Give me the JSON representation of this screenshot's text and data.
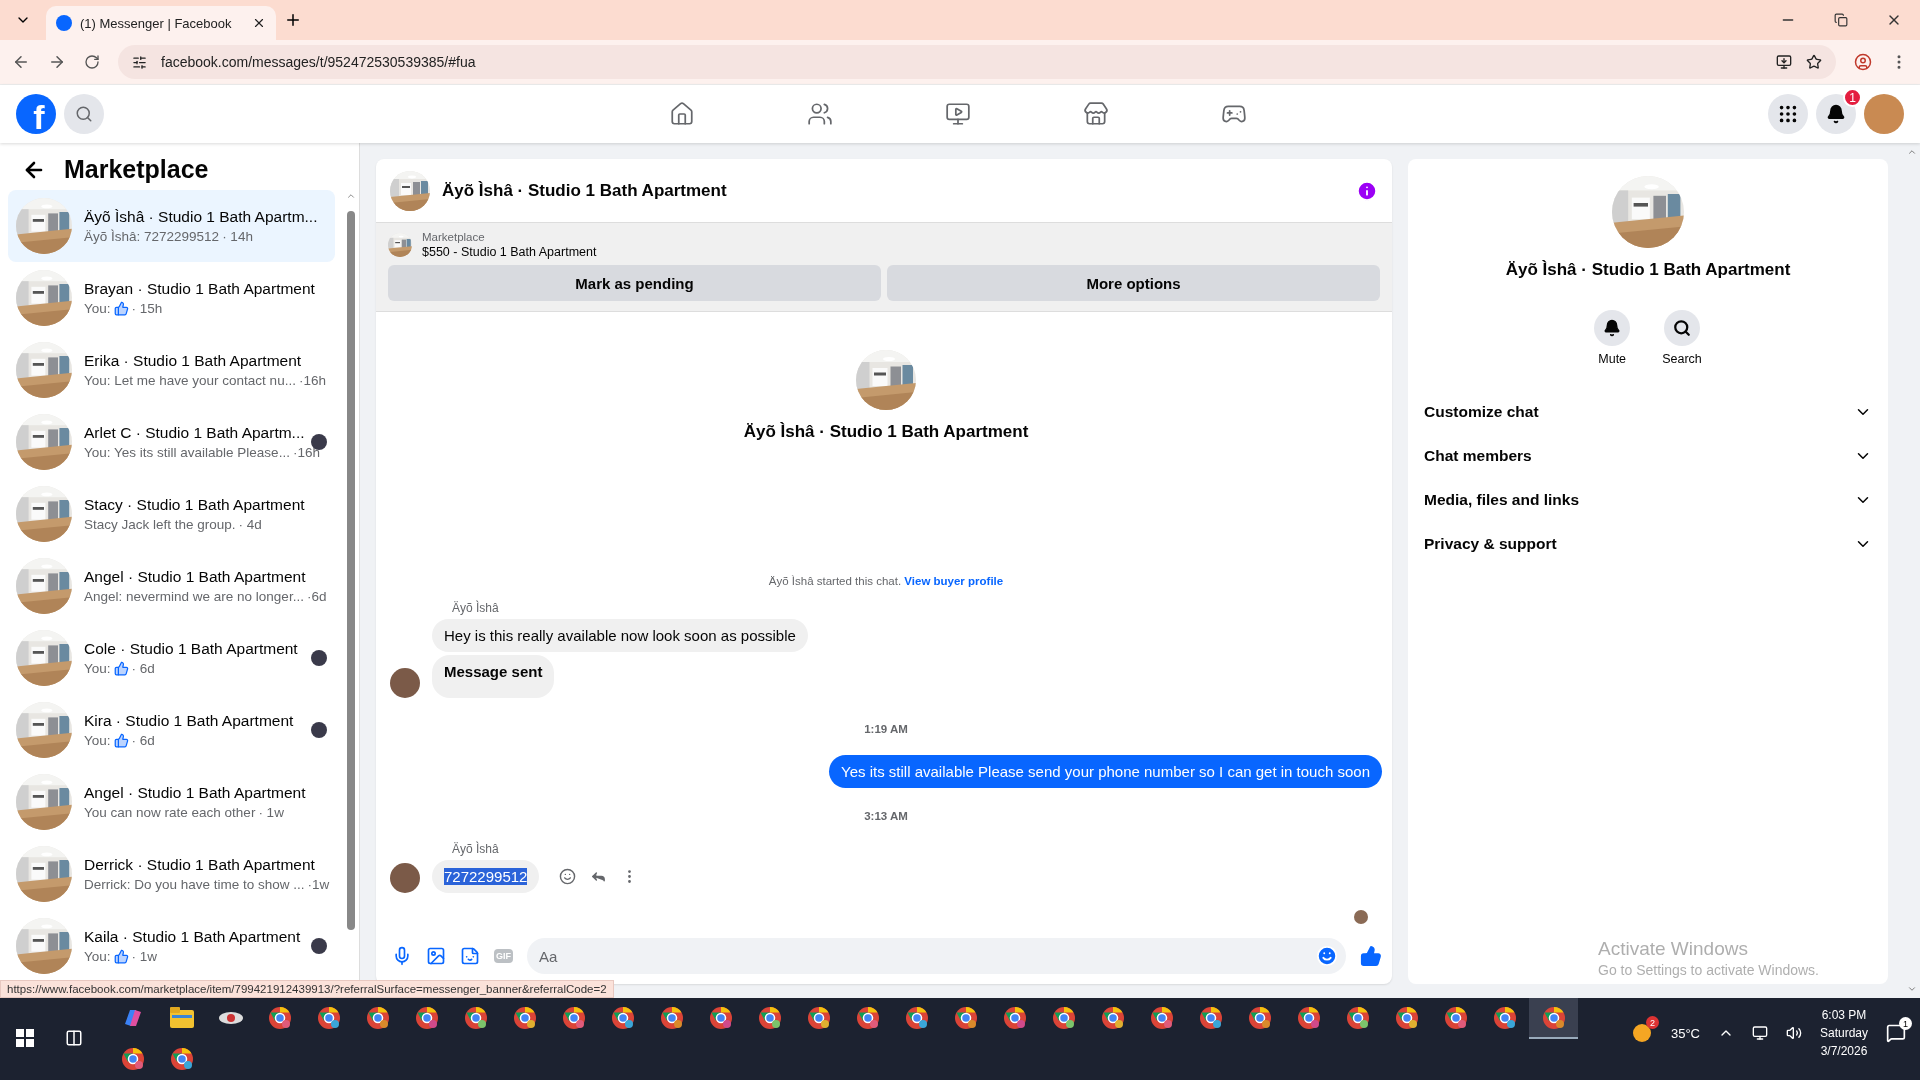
{
  "browser": {
    "tabs": [
      {
        "title": "(1) Messenger | Facebook",
        "selected": true
      }
    ],
    "address": "facebook.com/messages/t/952472530539385/#fua",
    "status_url": "https://www.facebook.com/marketplace/item/799421912439913/?referralSurface=messenger_banner&referralCode=2"
  },
  "header": {
    "logo": "f",
    "notification_count": "1"
  },
  "sidebar": {
    "title": "Marketplace",
    "conversations": [
      {
        "name": "Äyõ Ìshâ · Studio 1 Bath Apartm...",
        "preview": "Äyõ Ìshâ: 7272299512",
        "like": false,
        "time": "· 14h",
        "selected": true,
        "seen": false
      },
      {
        "name": "Brayan · Studio 1 Bath Apartment",
        "preview": "You:",
        "like": true,
        "time": "· 15h",
        "selected": false,
        "seen": false
      },
      {
        "name": "Erika · Studio 1 Bath Apartment",
        "preview": "You: Let me have your contact nu...",
        "like": false,
        "time": "·16h",
        "selected": false,
        "seen": false
      },
      {
        "name": "Arlet C · Studio 1 Bath Apartm...",
        "preview": "You: Yes its still available Please...",
        "like": false,
        "time": "·16h",
        "selected": false,
        "seen": true
      },
      {
        "name": "Stacy · Studio 1 Bath Apartment",
        "preview": "Stacy Jack left the group.",
        "like": false,
        "time": "· 4d",
        "selected": false,
        "seen": false
      },
      {
        "name": "Angel · Studio 1 Bath Apartment",
        "preview": "Angel: nevermind we are no longer...",
        "like": false,
        "time": "·6d",
        "selected": false,
        "seen": false
      },
      {
        "name": "Cole · Studio 1 Bath Apartment",
        "preview": "You:",
        "like": true,
        "time": "· 6d",
        "selected": false,
        "seen": true
      },
      {
        "name": "Kira · Studio 1 Bath Apartment",
        "preview": "You:",
        "like": true,
        "time": "· 6d",
        "selected": false,
        "seen": true
      },
      {
        "name": "Angel · Studio 1 Bath Apartment",
        "preview": "You can now rate each other",
        "like": false,
        "time": "· 1w",
        "selected": false,
        "seen": false
      },
      {
        "name": "Derrick · Studio 1 Bath Apartment",
        "preview": "Derrick: Do you have time to show ...",
        "like": false,
        "time": "·1w",
        "selected": false,
        "seen": false
      },
      {
        "name": "Kaila · Studio 1 Bath Apartment",
        "preview": "You:",
        "like": true,
        "time": "· 1w",
        "selected": false,
        "seen": true
      }
    ]
  },
  "chat": {
    "title": "Äyõ Ìshâ · Studio 1 Bath Apartment",
    "listing_label": "Marketplace",
    "listing": "$550 - Studio 1 Bath Apartment",
    "buttons": [
      "Mark as pending",
      "More options"
    ],
    "intro_name": "Äyõ Ìshâ · Studio 1 Bath Apartment",
    "started_text": "Äyõ Ìshâ started this chat.",
    "started_link": "View buyer profile",
    "messages": [
      {
        "kind": "sender",
        "text": "Äyõ Ìshâ"
      },
      {
        "kind": "incoming",
        "text": "Hey is this really available now look soon as possible",
        "bold": false,
        "avatar": false,
        "selected": false,
        "actions": false
      },
      {
        "kind": "incoming",
        "text": "Message sent",
        "bold": true,
        "avatar": true,
        "selected": false,
        "actions": false
      },
      {
        "kind": "time",
        "text": "1:19 AM"
      },
      {
        "kind": "outgoing",
        "text": "Yes its still available Please send your phone number so I can get in touch soon"
      },
      {
        "kind": "time",
        "text": "3:13 AM"
      },
      {
        "kind": "sender",
        "text": "Äyõ Ìshâ"
      },
      {
        "kind": "incoming",
        "text": "7272299512",
        "bold": false,
        "avatar": true,
        "selected": true,
        "actions": true
      }
    ],
    "seen": true,
    "composer": {
      "placeholder": "Aa",
      "gif_label": "GIF"
    }
  },
  "details": {
    "name": "Äyõ Ìshâ · Studio 1 Bath Apartment",
    "actions": [
      {
        "kind": "mute",
        "label": "Mute"
      },
      {
        "kind": "search",
        "label": "Search"
      }
    ],
    "sections": [
      {
        "label": "Customize chat",
        "expanded": false
      },
      {
        "label": "Chat members",
        "expanded": false
      },
      {
        "label": "Media, files and links",
        "expanded": false
      },
      {
        "label": "Privacy & support",
        "expanded": false
      }
    ]
  },
  "activation": {
    "title": "Activate Windows",
    "subtitle": "Go to Settings to activate Windows."
  },
  "taskbar": {
    "weather_badge": "2",
    "temperature": "35°C",
    "time": "6:03 PM",
    "day": "Saturday",
    "date": "3/7/2026",
    "notification_count": "1"
  }
}
